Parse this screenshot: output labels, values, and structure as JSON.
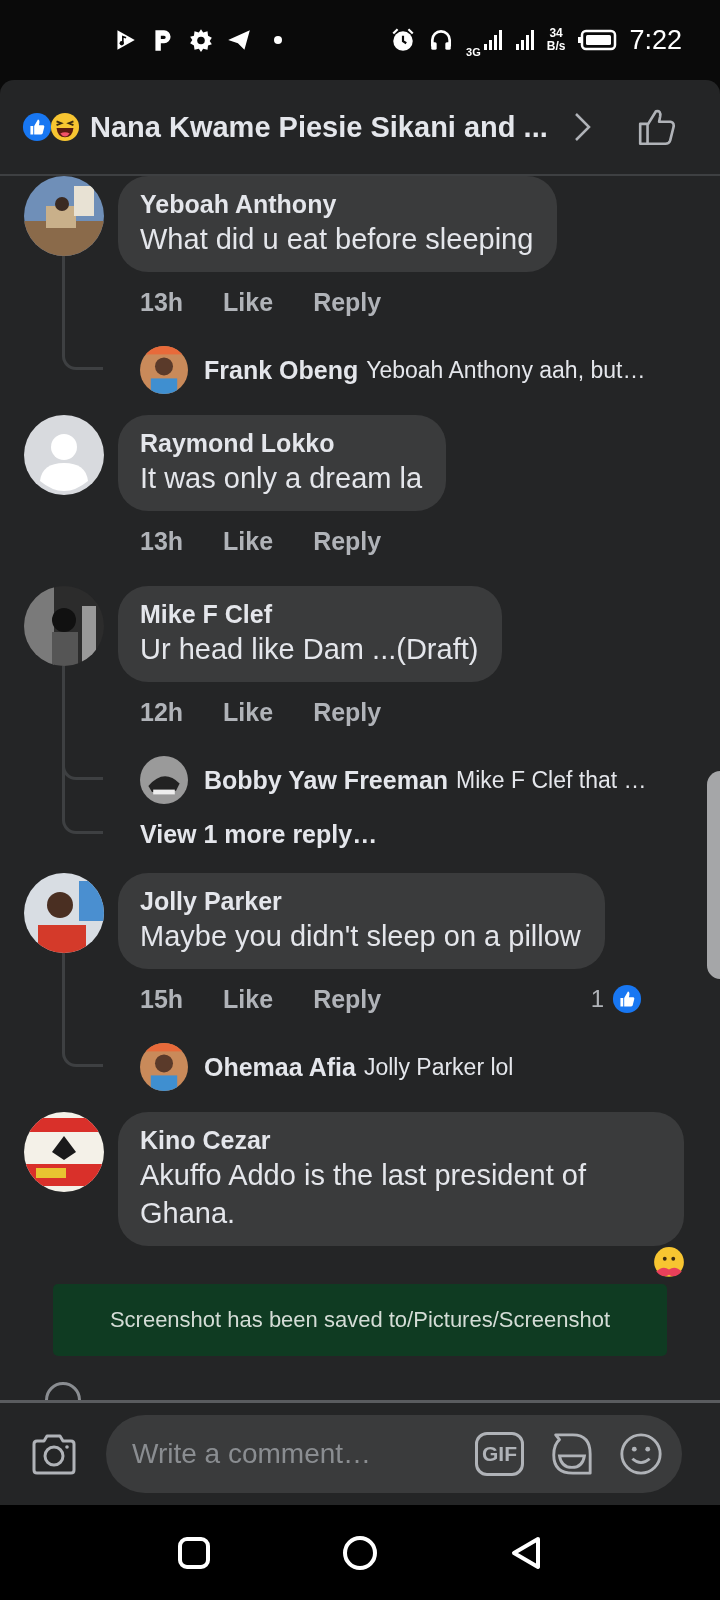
{
  "status_bar": {
    "network_type": "3G",
    "speed": "34",
    "speed_unit": "B/s",
    "time": "7:22"
  },
  "header": {
    "title": "Nana Kwame Piesie Sikani and ..."
  },
  "comments": [
    {
      "author": "Yeboah Anthony",
      "kind": "picture",
      "text": "What did u eat before sleeping",
      "time": "13h",
      "like": "Like",
      "reply": "Reply",
      "replies": [
        {
          "author": "Frank Obeng",
          "text": "Yeboah Anthony aah, but…"
        }
      ]
    },
    {
      "author": "Raymond Lokko",
      "kind": "silhouette",
      "text": "It was only a dream la",
      "time": "13h",
      "like": "Like",
      "reply": "Reply"
    },
    {
      "author": "Mike F Clef",
      "kind": "picture",
      "text": "Ur head like Dam ...(Draft)",
      "time": "12h",
      "like": "Like",
      "reply": "Reply",
      "replies": [
        {
          "author": "Bobby Yaw Freeman",
          "text": "Mike F Clef  that …"
        }
      ],
      "more_replies": "View 1 more reply…"
    },
    {
      "author": "Jolly Parker",
      "kind": "picture",
      "text": "Maybe you didn't sleep on a pillow",
      "time": "15h",
      "like": "Like",
      "reply": "Reply",
      "reaction_count": "1",
      "replies": [
        {
          "author": "Ohemaa Afia",
          "text": "Jolly Parker lol"
        }
      ]
    },
    {
      "author": "Kino Cezar",
      "kind": "picture",
      "text": "Akuffo Addo is the last president of Ghana.",
      "reaction_peek": true
    }
  ],
  "toast": {
    "text": "Screenshot has been saved to/Pictures/Screenshot"
  },
  "composer": {
    "placeholder": "Write a comment…",
    "gif_label": "GIF"
  }
}
